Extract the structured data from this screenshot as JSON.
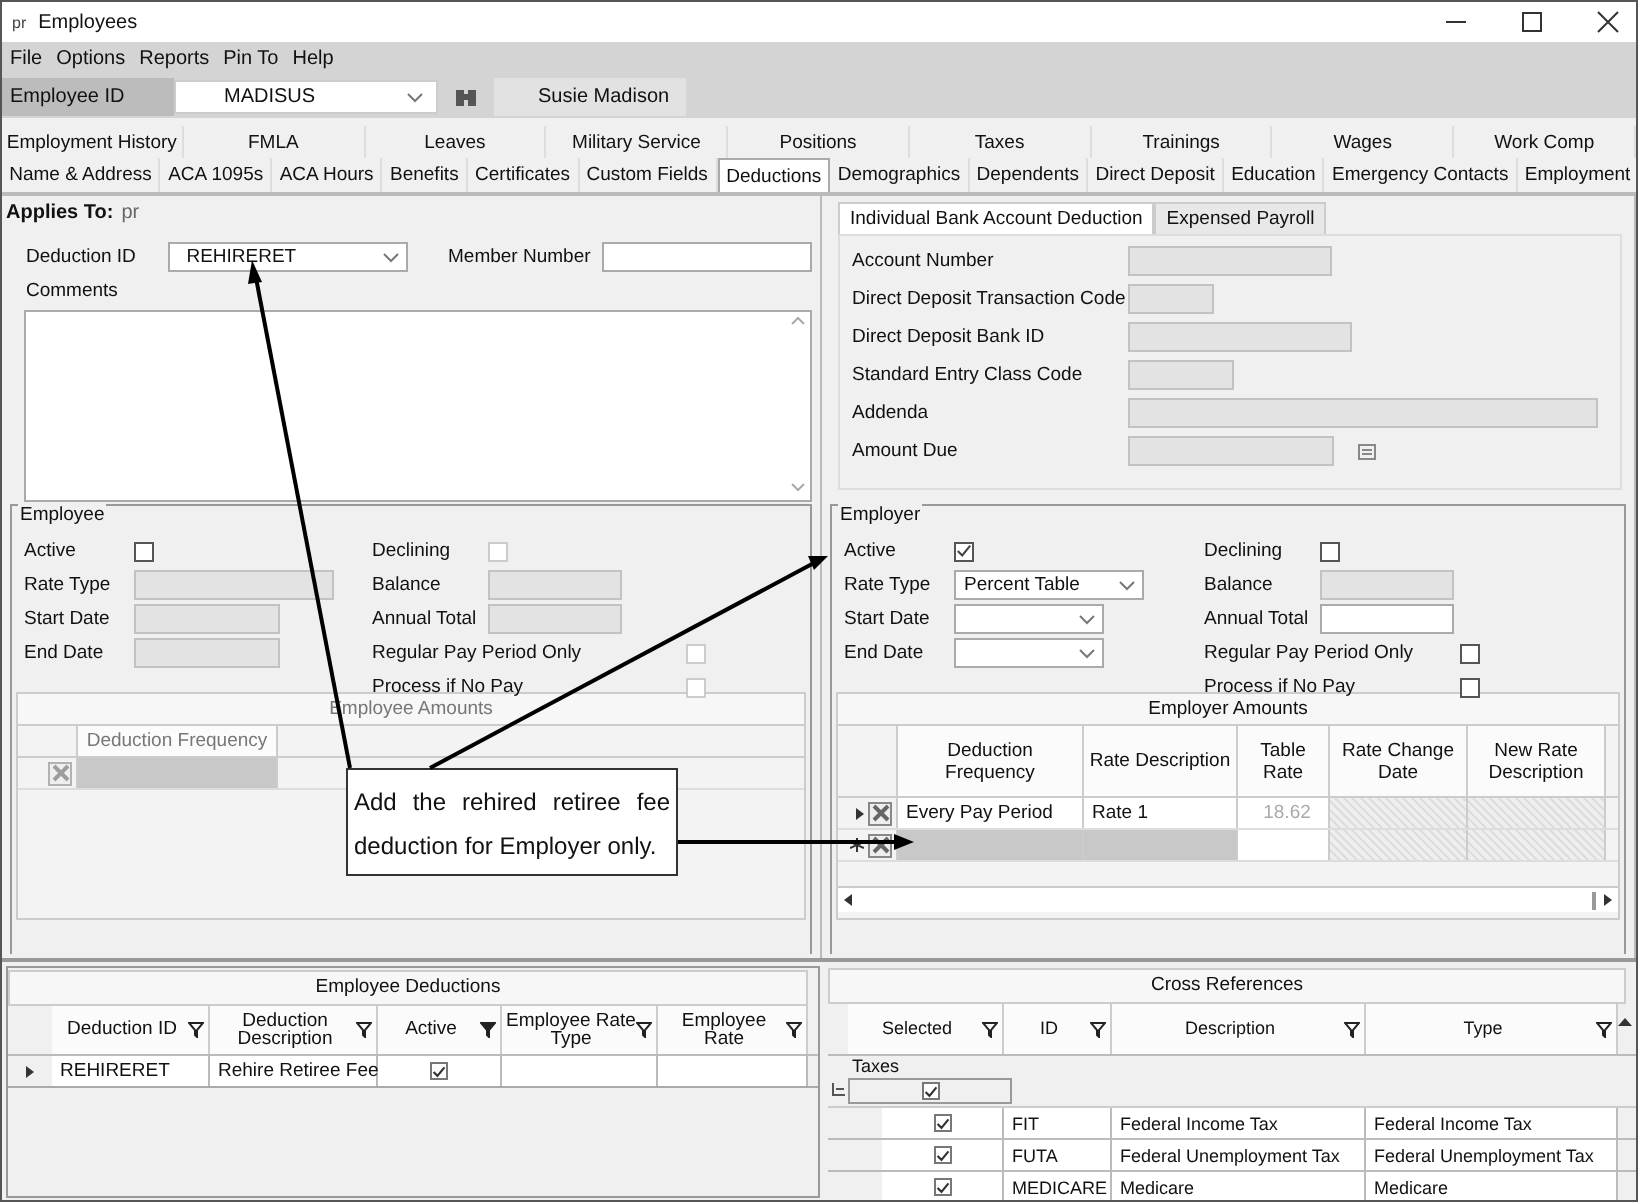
{
  "window": {
    "app_mark": "pr",
    "title": "Employees"
  },
  "menu": [
    "File",
    "Options",
    "Reports",
    "Pin To",
    "Help"
  ],
  "employee_bar": {
    "label": "Employee ID",
    "value": "MADISUS",
    "name": "Susie Madison"
  },
  "tabs_row_1": [
    {
      "label": "Employment History",
      "selected": false
    },
    {
      "label": "FMLA",
      "selected": false
    },
    {
      "label": "Leaves",
      "selected": false
    },
    {
      "label": "Military Service",
      "selected": false
    },
    {
      "label": "Positions",
      "selected": false
    },
    {
      "label": "Taxes",
      "selected": false
    },
    {
      "label": "Trainings",
      "selected": false
    },
    {
      "label": "Wages",
      "selected": false
    },
    {
      "label": "Work Comp",
      "selected": false
    }
  ],
  "tabs_row_2": [
    {
      "label": "Name & Address",
      "selected": false
    },
    {
      "label": "ACA 1095s",
      "selected": false
    },
    {
      "label": "ACA Hours",
      "selected": false
    },
    {
      "label": "Benefits",
      "selected": false
    },
    {
      "label": "Certificates",
      "selected": false
    },
    {
      "label": "Custom Fields",
      "selected": false
    },
    {
      "label": "Deductions",
      "selected": true
    },
    {
      "label": "Demographics",
      "selected": false
    },
    {
      "label": "Dependents",
      "selected": false
    },
    {
      "label": "Direct Deposit",
      "selected": false
    },
    {
      "label": "Education",
      "selected": false
    },
    {
      "label": "Emergency Contacts",
      "selected": false
    },
    {
      "label": "Employment",
      "selected": false
    }
  ],
  "applies_to": {
    "label": "Applies To:",
    "value": "pr"
  },
  "deduction": {
    "id_label": "Deduction ID",
    "id_value": "REHIRERET",
    "member_label": "Member Number",
    "comments_label": "Comments"
  },
  "bank_tabs": [
    {
      "label": "Individual Bank Account Deduction",
      "selected": true
    },
    {
      "label": "Expensed Payroll",
      "selected": false
    }
  ],
  "bank_fields": [
    {
      "label": "Account Number",
      "kind": "input"
    },
    {
      "label": "Direct Deposit Transaction Code",
      "kind": "input"
    },
    {
      "label": "Direct Deposit Bank ID",
      "kind": "input"
    },
    {
      "label": "Standard Entry Class Code",
      "kind": "input"
    },
    {
      "label": "Addenda",
      "kind": "input"
    },
    {
      "label": "Amount Due",
      "kind": "input_button"
    }
  ],
  "groups": [
    {
      "title": "Employee",
      "left": [
        {
          "label": "Active",
          "kind": "checkbox",
          "checked": false,
          "disabled": false
        },
        {
          "label": "Rate Type",
          "kind": "input",
          "disabled": true
        },
        {
          "label": "Start Date",
          "kind": "input",
          "disabled": true
        },
        {
          "label": "End Date",
          "kind": "input",
          "disabled": true
        }
      ],
      "right": [
        {
          "label": "Declining",
          "kind": "checkbox",
          "checked": false,
          "disabled": true
        },
        {
          "label": "Balance",
          "kind": "input",
          "disabled": true
        },
        {
          "label": "Annual Total",
          "kind": "input",
          "disabled": true
        },
        {
          "label": "Regular Pay Period Only",
          "kind": "checkbox",
          "checked": false,
          "disabled": true
        },
        {
          "label": "Process if No Pay",
          "kind": "checkbox",
          "checked": false,
          "disabled": true
        }
      ],
      "amounts": {
        "title": "Employee Amounts",
        "columns": [
          "Deduction Frequency"
        ],
        "rows": [
          {
            "kind": "blank"
          }
        ]
      }
    },
    {
      "title": "Employer",
      "left": [
        {
          "label": "Active",
          "kind": "checkbox",
          "checked": true,
          "disabled": false
        },
        {
          "label": "Rate Type",
          "kind": "dropdown",
          "value": "Percent Table",
          "disabled": false
        },
        {
          "label": "Start Date",
          "kind": "dropdown",
          "disabled": false
        },
        {
          "label": "End Date",
          "kind": "dropdown",
          "disabled": false
        }
      ],
      "right": [
        {
          "label": "Declining",
          "kind": "checkbox",
          "checked": false,
          "disabled": false
        },
        {
          "label": "Balance",
          "kind": "input",
          "disabled": true
        },
        {
          "label": "Annual Total",
          "kind": "input",
          "disabled": false
        },
        {
          "label": "Regular Pay Period Only",
          "kind": "checkbox",
          "checked": false,
          "disabled": false
        },
        {
          "label": "Process if No Pay",
          "kind": "checkbox",
          "checked": false,
          "disabled": false
        }
      ],
      "amounts": {
        "title": "Employer Amounts",
        "columns": [
          "Deduction Frequency",
          "Rate Description",
          "Table Rate",
          "Rate Change Date",
          "New Rate Description"
        ],
        "rows": [
          {
            "kind": "data",
            "cells": [
              "Every Pay Period",
              "Rate 1",
              "18.62"
            ]
          },
          {
            "kind": "new"
          }
        ]
      }
    }
  ],
  "callout": "Add the rehired retiree fee deduction for Employer only.",
  "employee_deductions": {
    "title": "Employee Deductions",
    "columns": [
      "Deduction ID",
      "Deduction Description",
      "Active",
      "Employee Rate Type",
      "Employee Rate"
    ],
    "rows": [
      {
        "id": "REHIRERET",
        "description": "Rehire Retiree Fee",
        "active": true
      }
    ]
  },
  "cross_references": {
    "title": "Cross References",
    "columns": [
      "Selected",
      "ID",
      "Description",
      "Type"
    ],
    "groups": [
      {
        "name": "Taxes",
        "selected": true,
        "rows": [
          {
            "selected": true,
            "id": "FIT",
            "description": "Federal Income Tax",
            "type": "Federal Income Tax"
          },
          {
            "selected": true,
            "id": "FUTA",
            "description": "Federal Unemployment Tax",
            "type": "Federal Unemployment Tax"
          },
          {
            "selected": true,
            "id": "MEDICARE",
            "description": "Medicare",
            "type": "Medicare"
          }
        ]
      }
    ]
  }
}
